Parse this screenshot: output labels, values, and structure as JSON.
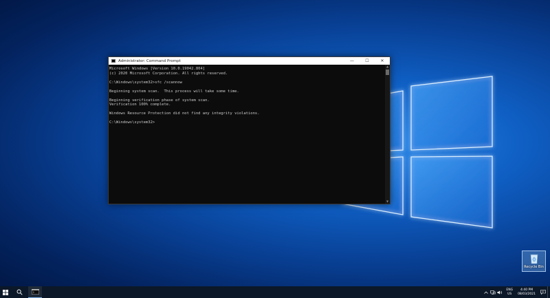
{
  "window": {
    "title": "Administrator: Command Prompt",
    "minimize_glyph": "—",
    "maximize_glyph": "☐",
    "close_glyph": "✕"
  },
  "console": {
    "lines": [
      "Microsoft Windows [Version 10.0.19042.804]",
      "(c) 2020 Microsoft Corporation. All rights reserved.",
      "",
      "C:\\Windows\\system32>sfc /scannow",
      "",
      "Beginning system scan.  This process will take some time.",
      "",
      "Beginning verification phase of system scan.",
      "Verification 100% complete.",
      "",
      "Windows Resource Protection did not find any integrity violations.",
      "",
      "C:\\Windows\\system32>"
    ]
  },
  "desktop": {
    "recycle_bin_label": "Recycle Bin"
  },
  "taskbar": {
    "language_line1": "ENG",
    "language_line2": "US",
    "time": "4:40 PM",
    "date": "08/03/2021",
    "icons": [
      "windows-start-icon",
      "search-icon",
      "cmd-app-icon",
      "chevron-up-icon",
      "network-icon",
      "volume-icon",
      "notification-icon"
    ]
  },
  "colors": {
    "console_background": "#0c0c0c",
    "console_text": "#cccccc",
    "taskbar": "#0c1828",
    "desktop_accent": "#0f5fc4"
  }
}
